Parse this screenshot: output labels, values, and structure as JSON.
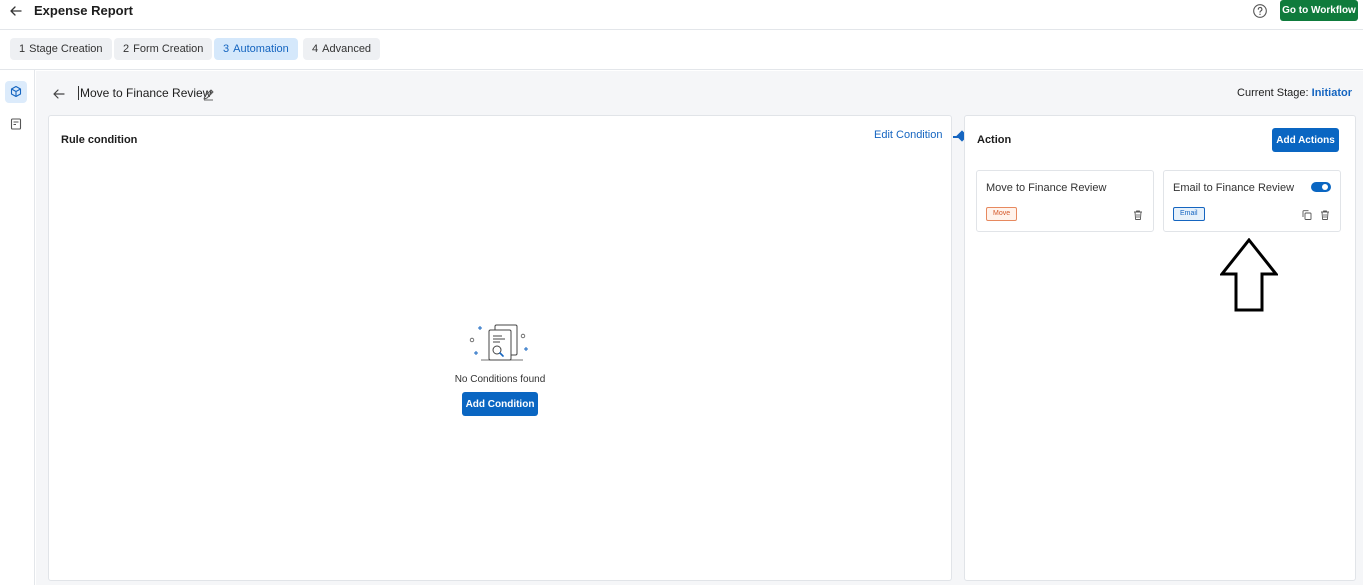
{
  "header": {
    "title": "Expense Report",
    "go_to_workflow": "Go to Workflow"
  },
  "steps": [
    {
      "num": "1",
      "label": "Stage Creation"
    },
    {
      "num": "2",
      "label": "Form Creation"
    },
    {
      "num": "3",
      "label": "Automation",
      "active": true
    },
    {
      "num": "4",
      "label": "Advanced"
    }
  ],
  "rule": {
    "name": "Move to Finance Review",
    "current_stage_label": "Current Stage:",
    "current_stage_value": "Initiator"
  },
  "condition_panel": {
    "title": "Rule condition",
    "edit_condition": "Edit Condition",
    "empty_text": "No Conditions found",
    "add_condition": "Add Condition"
  },
  "action_panel": {
    "title": "Action",
    "add_actions": "Add Actions",
    "cards": [
      {
        "title": "Move to Finance Review",
        "tag": "Move"
      },
      {
        "title": "Email to Finance Review",
        "tag": "Email",
        "enabled": true
      }
    ]
  },
  "colors": {
    "primary": "#0a66c2",
    "workflow_button": "#0f7b3c",
    "move_tag": "#d4582a",
    "email_tag": "#1565c0"
  }
}
